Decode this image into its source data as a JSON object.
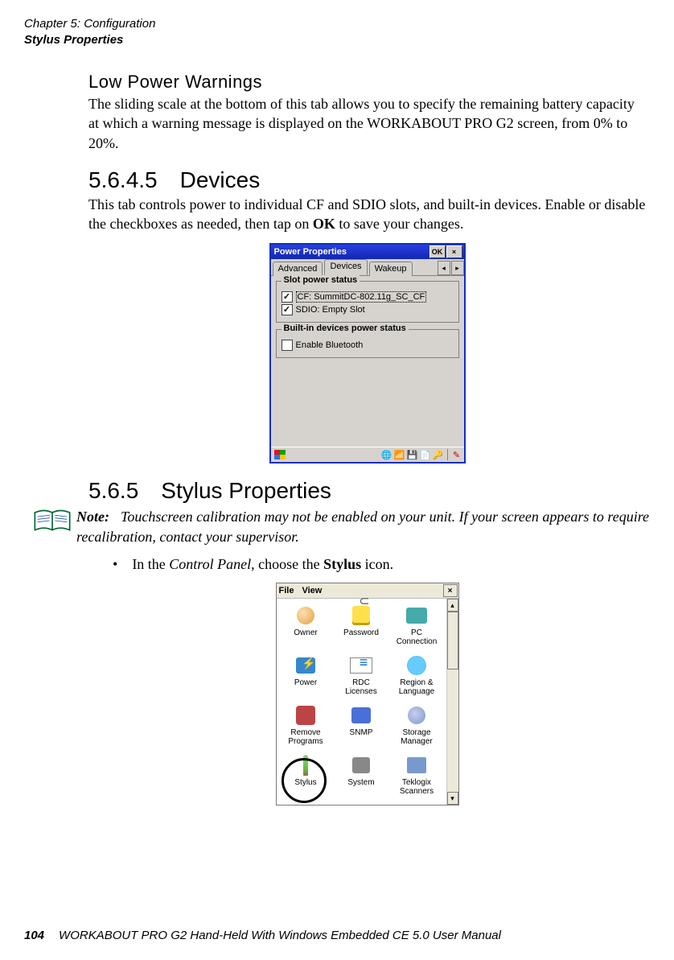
{
  "header": {
    "chapter": "Chapter 5: Configuration",
    "section": "Stylus Properties"
  },
  "lowpower": {
    "heading": "Low Power Warnings",
    "para": "The sliding scale at the bottom of this tab allows you to specify the remaining battery capacity at which a warning message is displayed on the WORKABOUT PRO G2 screen, from 0% to 20%."
  },
  "devices": {
    "num": "5.6.4.5",
    "title": "Devices",
    "para_pre": "This tab controls power to individual CF and SDIO slots, and built-in devices. Enable or disable the checkboxes as needed, then tap on ",
    "para_bold": "OK",
    "para_post": " to save your changes."
  },
  "stylus": {
    "num": "5.6.5",
    "title": "Stylus Properties",
    "note_label": "Note:",
    "note_body": "Touchscreen calibration may not be enabled on your unit. If your screen appears to require recalibration, contact your supervisor.",
    "bullet_pre": "In the ",
    "bullet_em": "Control Panel",
    "bullet_mid": ", choose the ",
    "bullet_bold": "Stylus",
    "bullet_post": " icon."
  },
  "dialog1": {
    "title": "Power Properties",
    "ok": "OK",
    "close": "×",
    "tabs": {
      "advanced": "Advanced",
      "devices": "Devices",
      "wakeup": "Wakeup"
    },
    "scroll_left": "◂",
    "scroll_right": "▸",
    "group1": {
      "legend": "Slot power status",
      "item1": "CF: SummitDC-802.11g_SC_CF",
      "item2": "SDIO: Empty Slot"
    },
    "group2": {
      "legend": "Built-in devices power status",
      "item1": "Enable Bluetooth"
    },
    "check_on": "✓",
    "check_off": ""
  },
  "dialog2": {
    "menu_file": "File",
    "menu_view": "View",
    "close": "×",
    "scroll_up": "▴",
    "scroll_down": "▾",
    "items": {
      "owner": "Owner",
      "password": "Password",
      "pcconn": "PC\nConnection",
      "power": "Power",
      "rdc": "RDC\nLicenses",
      "region": "Region &\nLanguage",
      "remove": "Remove\nPrograms",
      "snmp": "SNMP",
      "storage": "Storage\nManager",
      "stylus": "Stylus",
      "system": "System",
      "teklogix": "Teklogix\nScanners"
    }
  },
  "footer": {
    "page": "104",
    "text": "WORKABOUT PRO G2 Hand-Held With Windows Embedded CE 5.0 User Manual"
  }
}
